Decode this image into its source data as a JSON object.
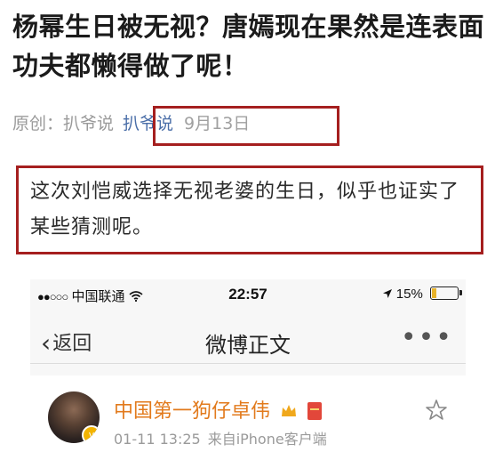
{
  "article": {
    "headline": "杨幂生日被无视？唐嫣现在果然是连表面功夫都懒得做了呢！",
    "meta_label": "原创：扒爷说",
    "author_link": "扒爷说",
    "date": "9月13日",
    "summary": "这次刘恺威选择无视老婆的生日，似乎也证实了某些猜测呢。"
  },
  "phone": {
    "status": {
      "signal": "●●○○○",
      "carrier": "中国联通",
      "time": "22:57",
      "battery_pct": "15%",
      "battery_level": 0.15
    },
    "nav": {
      "back_label": "返回",
      "title": "微博正文",
      "more": "•••"
    },
    "post": {
      "username": "中国第一狗仔卓伟",
      "timestamp": "01-11 13:25",
      "source": "来自iPhone客户端"
    }
  },
  "colors": {
    "highlight_box": "#a51f1f",
    "username": "#e27a1c",
    "author_link": "#4a6ea8"
  }
}
